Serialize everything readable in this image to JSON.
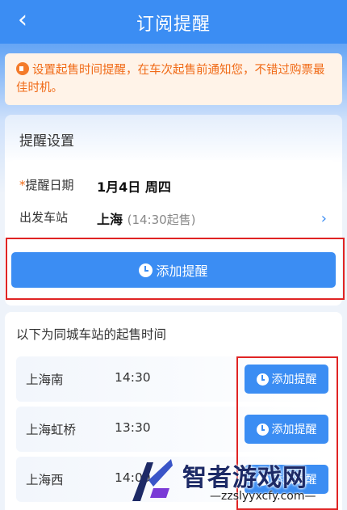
{
  "header": {
    "back_icon": "chevron-left-icon",
    "title": "订阅提醒"
  },
  "notice": {
    "icon": "megaphone-icon",
    "text": "设置起售时间提醒，在车次起售前通知您，不错过购票最佳时机。"
  },
  "settings": {
    "title": "提醒设置",
    "date_label": "提醒日期",
    "date_value": "1月4日 周四",
    "station_label": "出发车站",
    "station_value": "上海",
    "station_sub": "(14:30起售)",
    "add_button": "添加提醒"
  },
  "stations": {
    "title": "以下为同城车站的起售时间",
    "items": [
      {
        "name": "上海南",
        "time": "14:30",
        "button": "添加提醒"
      },
      {
        "name": "上海虹桥",
        "time": "13:30",
        "button": "添加提醒"
      },
      {
        "name": "上海西",
        "time": "14:00",
        "button": "添加提醒"
      }
    ]
  },
  "watermark": {
    "text": "智者游戏网",
    "url": "—zzslyyxcfy.com—"
  },
  "colors": {
    "primary": "#3b8df3",
    "notice": "#f06a16",
    "highlight": "#e02424"
  }
}
